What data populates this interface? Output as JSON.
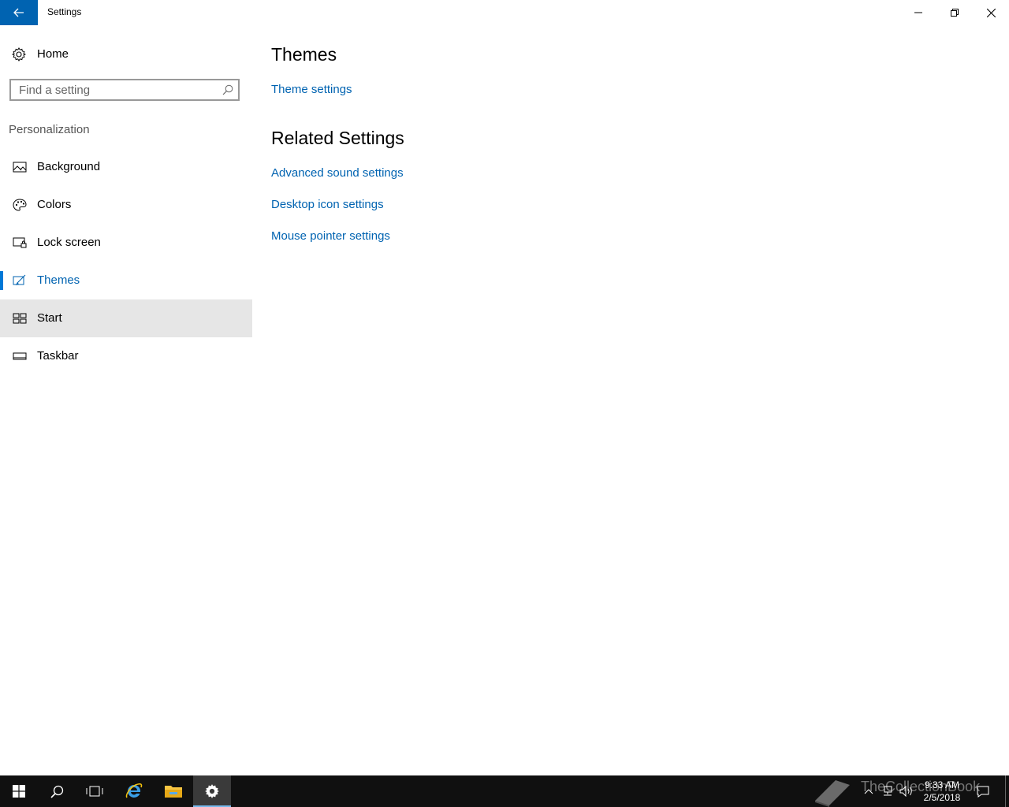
{
  "window": {
    "title": "Settings"
  },
  "sidebar": {
    "home_label": "Home",
    "search_placeholder": "Find a setting",
    "section_title": "Personalization",
    "items": [
      {
        "label": "Background",
        "icon": "picture-icon"
      },
      {
        "label": "Colors",
        "icon": "palette-icon"
      },
      {
        "label": "Lock screen",
        "icon": "lock-screen-icon"
      },
      {
        "label": "Themes",
        "icon": "brush-icon",
        "active": true
      },
      {
        "label": "Start",
        "icon": "start-tiles-icon",
        "hover": true
      },
      {
        "label": "Taskbar",
        "icon": "taskbar-icon"
      }
    ]
  },
  "main": {
    "themes_heading": "Themes",
    "theme_settings_link": "Theme settings",
    "related_heading": "Related Settings",
    "related_links": [
      "Advanced sound settings",
      "Desktop icon settings",
      "Mouse pointer settings"
    ]
  },
  "taskbar": {
    "time": "9:33 AM",
    "date": "2/5/2018",
    "watermark": "TheCollectionBook"
  },
  "colors": {
    "accent": "#0063b1",
    "active_bar": "#0078d7",
    "hover_bg": "#e6e6e6",
    "taskbar_bg": "#101010"
  }
}
